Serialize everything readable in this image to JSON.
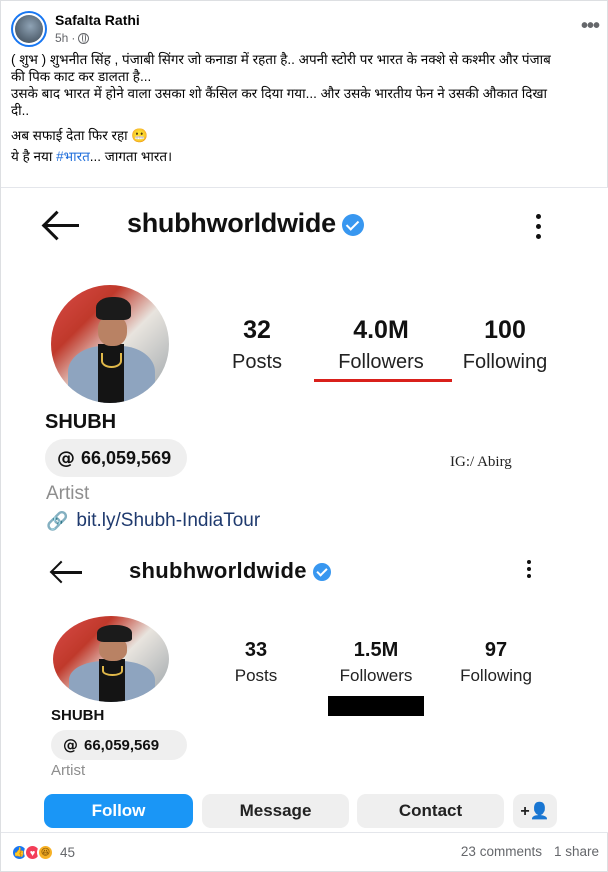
{
  "post": {
    "author": "Safalta Rathi",
    "time": "5h",
    "more": "•••",
    "caption_lines": [
      "( शुभ ) शुभनीत सिंह , पंजाबी सिंगर जो कनाडा में रहता है.. अपनी स्टोरी पर भारत के नक्शे से कश्मीर और पंजाब",
      "की पिक काट कर डालता है...",
      "उसके बाद भारत में होने वाला उसका शो कैंसिल कर दिया गया... और उसके भारतीय फेन ने उसकी औकात दिखा",
      "दी.."
    ],
    "caption_line5": "अब सफाई देता फिर रहा 😬",
    "caption_line6_prefix": "ये है नया ",
    "caption_hashtag": "#भारत",
    "caption_line6_suffix": "... जागता भारत।"
  },
  "screenshot_top": {
    "handle": "shubhworldwide",
    "posts_count": "32",
    "posts_label": "Posts",
    "followers_count": "4.0M",
    "followers_label": "Followers",
    "following_count": "100",
    "following_label": "Following",
    "name": "SHUBH",
    "threads_count": "66,059,569",
    "category": "Artist",
    "link": "bit.ly/Shubh-IndiaTour",
    "watermark": "IG:/ Abirg"
  },
  "screenshot_bottom": {
    "handle": "shubhworldwide",
    "posts_count": "33",
    "posts_label": "Posts",
    "followers_count": "1.5M",
    "followers_label": "Followers",
    "following_count": "97",
    "following_label": "Following",
    "name": "SHUBH",
    "threads_count": "66,059,569",
    "category": "Artist",
    "buttons": {
      "follow": "Follow",
      "message": "Message",
      "contact": "Contact",
      "add_user_glyph": "+👤"
    }
  },
  "footer": {
    "reaction_count": "45",
    "comments": "23 comments",
    "shares": "1 share"
  },
  "colors": {
    "accent": "#1877f2",
    "follow_button": "#1a96f6",
    "verified": "#3897f0",
    "underline": "#d9201b"
  }
}
